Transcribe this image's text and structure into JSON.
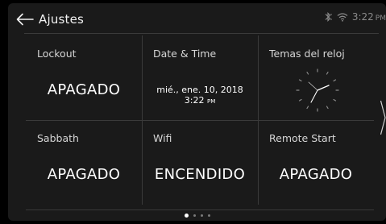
{
  "header": {
    "title": "Ajustes",
    "time": "3:22",
    "ampm": "PM",
    "icons": [
      "back-arrow-icon",
      "bluetooth-icon",
      "wifi-icon"
    ]
  },
  "tiles": [
    {
      "label": "Lockout",
      "value": "APAGADO"
    },
    {
      "label": "Date & Time",
      "date": "mié., ene. 10, 2018",
      "time": "3:22",
      "ampm": "PM"
    },
    {
      "label": "Temas del reloj",
      "icon": "analog-clock-icon"
    },
    {
      "label": "Sabbath",
      "value": "APAGADO"
    },
    {
      "label": "Wifi",
      "value": "ENCENDIDO"
    },
    {
      "label": "Remote Start",
      "value": "APAGADO"
    }
  ],
  "pagination": {
    "pages": 4,
    "current": 1
  },
  "colors": {
    "background": "#000000",
    "panel": "#1a1a1a",
    "divider": "#3a3a3a",
    "text": "#ffffff",
    "muted": "#8a8a8a"
  }
}
